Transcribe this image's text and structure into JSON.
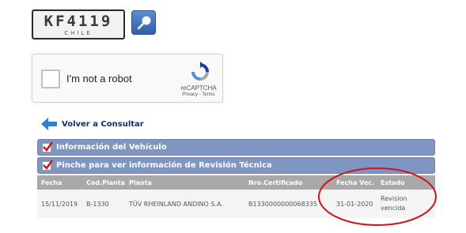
{
  "plate": {
    "number": "KF4119",
    "country": "CHILE"
  },
  "recaptcha": {
    "label": "I'm not a robot",
    "brand": "reCAPTCHA",
    "links": "Privacy - Terms"
  },
  "back": {
    "label": "Volver a Consultar"
  },
  "sections": [
    {
      "label": "Información del Vehículo"
    },
    {
      "label": "Pinche para ver información de Revisión Técnica"
    }
  ],
  "table": {
    "headers": [
      "Fecha",
      "Cod.Planta",
      "Planta",
      "Nro.Certificado",
      "Fecha Vec.",
      "Estado"
    ],
    "rows": [
      [
        "15/11/2019",
        "B-1330",
        "TÜV RHEINLAND ANDINO S.A.",
        "B1330000000068335",
        "31-01-2020",
        "Revision vencida"
      ]
    ]
  },
  "colors": {
    "section_bar": "#7f96c3",
    "table_header": "#a9a9a9",
    "highlight": "#d0141c",
    "link": "#0b2f7a"
  }
}
